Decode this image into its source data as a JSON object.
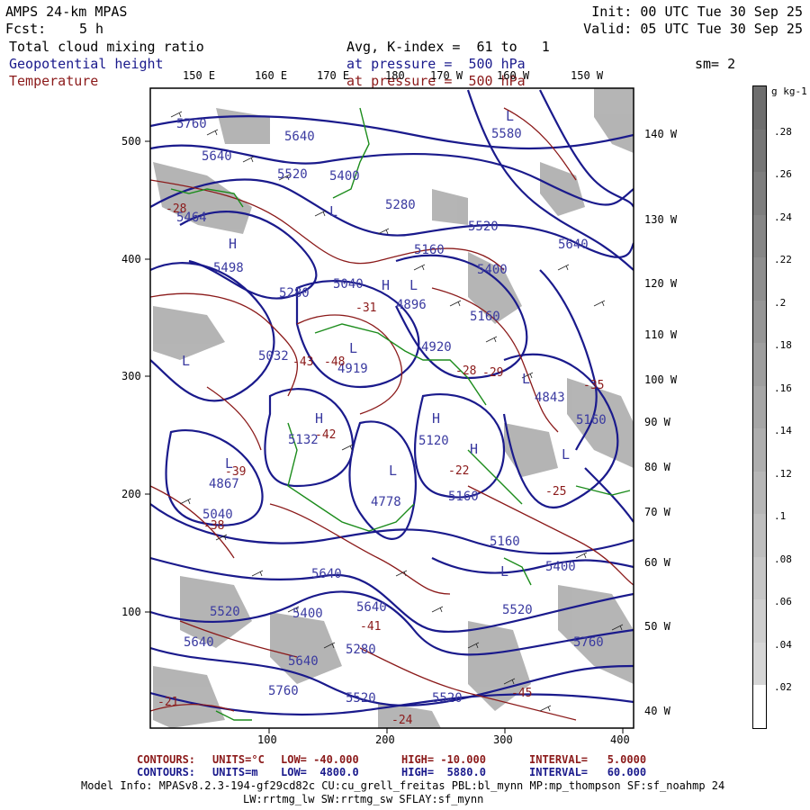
{
  "header": {
    "model": "AMPS 24-km MPAS",
    "fcst_label": "Fcst:",
    "fcst_value": "5 h",
    "init": "Init: 00 UTC Tue 30 Sep 25",
    "valid": "Valid: 05 UTC Tue 30 Sep 25",
    "field1": "Total cloud mixing ratio",
    "avg": "Avg, K-index =  61 to   1",
    "field2": "Geopotential height",
    "pressure1": "at pressure =  500 hPa",
    "sm": "sm= 2",
    "field3": "Temperature",
    "pressure2": "at pressure =  500 hPa"
  },
  "colors": {
    "height_contour": "#1a1a8c",
    "temperature_contour": "#8b1a1a",
    "coastline": "#1c8c1c",
    "cloud_shading": "#9a9a9a"
  },
  "top_lon_labels": [
    "150 E",
    "160 E",
    "170 E",
    "180",
    "170 W",
    "160 W",
    "150 W"
  ],
  "right_lon_labels": [
    "140 W",
    "130 W",
    "120 W",
    "110 W",
    "100 W",
    "90 W",
    "80 W",
    "70 W",
    "60 W",
    "50 W",
    "40 W"
  ],
  "x_ticks": [
    "100",
    "200",
    "300",
    "400"
  ],
  "y_ticks": [
    "500",
    "400",
    "300",
    "200",
    "100"
  ],
  "colorbar": {
    "units": "g kg-1",
    "labels": [
      ".28",
      ".26",
      ".24",
      ".22",
      ".2",
      ".18",
      ".16",
      ".14",
      ".12",
      ".1",
      ".08",
      ".06",
      ".04",
      ".02"
    ],
    "colors": [
      "#6e6e6e",
      "#767676",
      "#7e7e7e",
      "#868686",
      "#8e8e8e",
      "#969696",
      "#9e9e9e",
      "#a6a6a6",
      "#aeaeae",
      "#b6b6b6",
      "#bebebe",
      "#c6c6c6",
      "#cecece",
      "#d6d6d6",
      "#ffffff"
    ]
  },
  "height_labels": [
    "5760",
    "5640",
    "5640",
    "5520",
    "5400",
    "5280",
    "5464",
    "5498",
    "5160",
    "5280",
    "5040",
    "4896",
    "5160",
    "4920",
    "4919",
    "5032",
    "5132",
    "5120",
    "4867",
    "5040",
    "5160",
    "5400",
    "4778",
    "5520",
    "5640",
    "5160",
    "5640",
    "5520",
    "5640",
    "5280",
    "5400",
    "5520",
    "5520",
    "5640",
    "5760",
    "5760",
    "5580",
    "5520",
    "5640",
    "5400",
    "4843",
    "5160"
  ],
  "temperature_labels": [
    "-28",
    "-31",
    "-43",
    "-48",
    "-42",
    "-39",
    "-28",
    "-21",
    "-24",
    "-22",
    "-45",
    "-38",
    "-35",
    "-25",
    "-29",
    "-41"
  ],
  "extrema_letters": [
    "H",
    "L",
    "H",
    "L",
    "L",
    "H",
    "L",
    "H",
    "L",
    "L",
    "L",
    "L",
    "H",
    "L",
    "L"
  ],
  "footer": {
    "line1": {
      "label": "CONTOURS:",
      "units": "UNITS=°C",
      "low": "LOW= -40.000",
      "high": "HIGH= -10.000",
      "interval": "INTERVAL=   5.0000"
    },
    "line2": {
      "label": "CONTOURS:",
      "units": "UNITS=m",
      "low": "LOW=  4800.0",
      "high": "HIGH=  5880.0",
      "interval": "INTERVAL=   60.000"
    },
    "model_info": "Model Info: MPASv8.2.3-194-gf29cd82c CU:cu_grell_freitas PBL:bl_mynn MP:mp_thompson SF:sf_noahmp 24",
    "model_info2": "LW:rrtmg_lw SW:rrtmg_sw SFLAY:sf_mynn"
  }
}
